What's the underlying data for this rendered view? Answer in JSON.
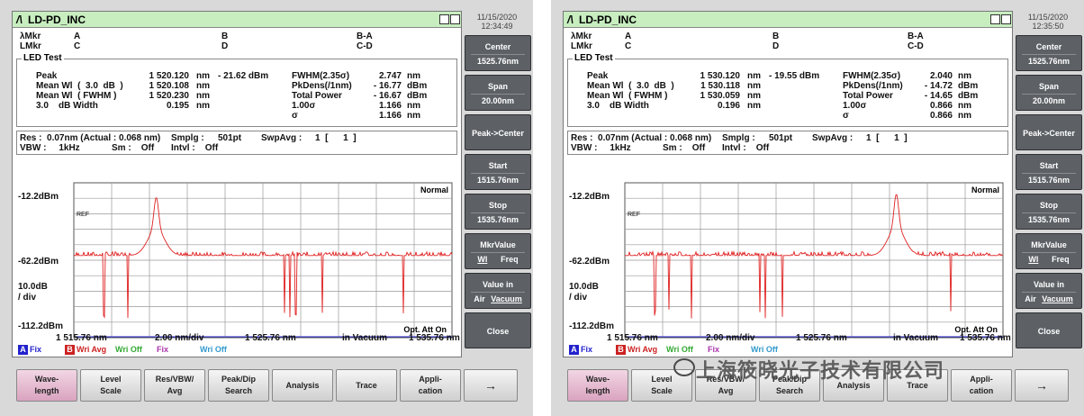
{
  "instruments": [
    {
      "title": "LD-PD_INC",
      "datetime": {
        "date": "11/15/2020",
        "time": "12:34:49"
      },
      "markers": {
        "lambda_label": "λMkr",
        "l_label": "LMkr",
        "col_a": "A",
        "col_b": "B",
        "col_ba": "B-A",
        "col_c": "C",
        "col_d": "D",
        "col_cd": "C-D"
      },
      "led_test_label": "LED Test",
      "led": {
        "peak_label": "Peak",
        "peak_val": "1 520.120",
        "peak_unit": "nm",
        "peak_power": "- 21.62 dBm",
        "mean3_label": "Mean Wl  (  3.0  dB  )",
        "mean3_val": "1 520.108",
        "mean3_unit": "nm",
        "meanf_label": "Mean Wl  ( FWHM )",
        "meanf_val": "1 520.230",
        "meanf_unit": "nm",
        "width_label": "3.0    dB Width",
        "width_val": "0.195",
        "width_unit": "nm",
        "fwhm_label": "FWHM(2.35σ)",
        "fwhm_val": "2.747",
        "fwhm_unit": "nm",
        "pkdens_label": "PkDens(/1nm)",
        "pkdens_val": "- 16.77",
        "pkdens_unit": "dBm",
        "total_label": "Total Power",
        "total_val": "- 16.67",
        "total_unit": "dBm",
        "sigma1_label": "1.00σ",
        "sigma1_val": "1.166",
        "sigma1_unit": "nm",
        "sigma_label": "σ",
        "sigma_val": "1.166",
        "sigma_unit": "nm"
      },
      "res": {
        "res": "Res :  0.07nm (Actual : 0.068 nm)",
        "smplg_label": "Smplg :",
        "smplg_val": "501pt",
        "swpavg_label": "SwpAvg :",
        "swpavg_val": "1  [      1  ]",
        "vbw": "VBW :     1kHz",
        "sm": "Sm :    Off",
        "intvl": "Intvl :    Off"
      },
      "plot": {
        "mode": "Normal",
        "ref": "REF",
        "y_top": "-12.2dBm",
        "y_mid": "-62.2dBm",
        "y_div": "10.0dB",
        "y_div2": "/ div",
        "y_bot": "-112.2dBm",
        "x_start": "1 515.76 nm",
        "x_step": "2.00 nm/div",
        "x_center": "1 525.76 nm",
        "x_medium": "in Vacuum",
        "x_stop": "1 535.76 nm",
        "opt_att": "Opt. Att On"
      },
      "traces": [
        {
          "tag": "A",
          "label": "Fix",
          "color": "#2222cc"
        },
        {
          "tag": "B",
          "label": "Wri Avg",
          "color": "#cc2222"
        },
        {
          "tag": "",
          "label": "Wri Off",
          "color": "#33aa33"
        },
        {
          "tag": "",
          "label": "Fix",
          "color": "#aa33aa"
        },
        {
          "tag": "",
          "label": "Wri Off",
          "color": "#3399cc"
        }
      ],
      "chart_data": {
        "type": "line",
        "x_range_nm": [
          1515.76,
          1535.76
        ],
        "ylim_dBm": [
          -112.2,
          -12.2
        ],
        "peak": {
          "x_nm": 1520.12,
          "y_dBm": -21.62
        },
        "noise_floor_dBm": -62.2,
        "dips_nm": [
          1517.36,
          1518.6,
          1526.9,
          1527.2,
          1527.5,
          1528.9,
          1533.2
        ]
      }
    },
    {
      "title": "LD-PD_INC",
      "datetime": {
        "date": "11/15/2020",
        "time": "12:35:50"
      },
      "markers": {
        "lambda_label": "λMkr",
        "l_label": "LMkr",
        "col_a": "A",
        "col_b": "B",
        "col_ba": "B-A",
        "col_c": "C",
        "col_d": "D",
        "col_cd": "C-D"
      },
      "led_test_label": "LED Test",
      "led": {
        "peak_label": "Peak",
        "peak_val": "1 530.120",
        "peak_unit": "nm",
        "peak_power": "- 19.55 dBm",
        "mean3_label": "Mean Wl  (  3.0  dB  )",
        "mean3_val": "1 530.118",
        "mean3_unit": "nm",
        "meanf_label": "Mean Wl  ( FWHM )",
        "meanf_val": "1 530.059",
        "meanf_unit": "nm",
        "width_label": "3.0    dB Width",
        "width_val": "0.196",
        "width_unit": "nm",
        "fwhm_label": "FWHM(2.35σ)",
        "fwhm_val": "2.040",
        "fwhm_unit": "nm",
        "pkdens_label": "PkDens(/1nm)",
        "pkdens_val": "- 14.72",
        "pkdens_unit": "dBm",
        "total_label": "Total Power",
        "total_val": "- 14.65",
        "total_unit": "dBm",
        "sigma1_label": "1.00σ",
        "sigma1_val": "0.866",
        "sigma1_unit": "nm",
        "sigma_label": "σ",
        "sigma_val": "0.866",
        "sigma_unit": "nm"
      },
      "res": {
        "res": "Res :  0.07nm (Actual : 0.068 nm)",
        "smplg_label": "Smplg :",
        "smplg_val": "501pt",
        "swpavg_label": "SwpAvg :",
        "swpavg_val": "1  [      1  ]",
        "vbw": "VBW :     1kHz",
        "sm": "Sm :    Off",
        "intvl": "Intvl :    Off"
      },
      "plot": {
        "mode": "Normal",
        "ref": "REF",
        "y_top": "-12.2dBm",
        "y_mid": "-62.2dBm",
        "y_div": "10.0dB",
        "y_div2": "/ div",
        "y_bot": "-112.2dBm",
        "x_start": "1 515.76 nm",
        "x_step": "2.00 nm/div",
        "x_center": "1 525.76 nm",
        "x_medium": "in Vacuum",
        "x_stop": "1 535.76 nm",
        "opt_att": "Opt. Att On"
      },
      "traces": [
        {
          "tag": "A",
          "label": "Fix",
          "color": "#2222cc"
        },
        {
          "tag": "B",
          "label": "Wri Avg",
          "color": "#cc2222"
        },
        {
          "tag": "",
          "label": "Wri Off",
          "color": "#33aa33"
        },
        {
          "tag": "",
          "label": "Fix",
          "color": "#aa33aa"
        },
        {
          "tag": "",
          "label": "Wri Off",
          "color": "#3399cc"
        }
      ],
      "chart_data": {
        "type": "line",
        "x_range_nm": [
          1515.76,
          1535.76
        ],
        "ylim_dBm": [
          -112.2,
          -12.2
        ],
        "peak": {
          "x_nm": 1530.12,
          "y_dBm": -19.55
        },
        "noise_floor_dBm": -62.2,
        "dips_nm": [
          1517.36,
          1518.1,
          1519.3,
          1522.9,
          1523.2,
          1524.1,
          1533.0
        ]
      }
    }
  ],
  "softkeys": [
    {
      "label": "Center",
      "value": "1525.76nm"
    },
    {
      "label": "Span",
      "value": "20.00nm"
    },
    {
      "label": "Peak->Center",
      "value": ""
    },
    {
      "label": "Start",
      "value": "1515.76nm"
    },
    {
      "label": "Stop",
      "value": "1535.76nm"
    },
    {
      "label": "MkrValue",
      "opt1": "Wl",
      "opt2": "Freq"
    },
    {
      "label": "Value in",
      "opt1": "Air",
      "opt2": "Vacuum"
    },
    {
      "label": "Close",
      "value": ""
    }
  ],
  "bottomkeys": [
    [
      "Wave-",
      "length"
    ],
    [
      "Level",
      "Scale"
    ],
    [
      "Res/VBW/",
      "Avg"
    ],
    [
      "Peak/Dip",
      "Search"
    ],
    [
      "Analysis",
      ""
    ],
    [
      "Trace",
      ""
    ],
    [
      "Appli-",
      "cation"
    ],
    [
      "→",
      ""
    ]
  ],
  "watermark": "上海筱晓光子技术有限公司"
}
